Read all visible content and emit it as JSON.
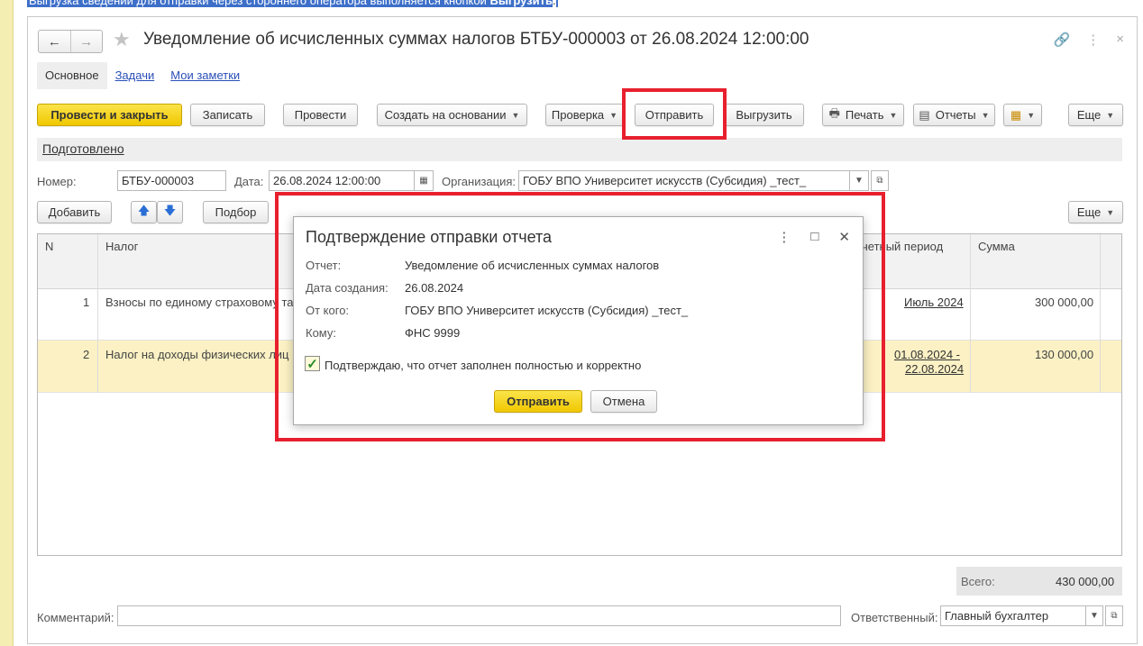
{
  "top_caption": {
    "text": "Выгрузка сведений для отправки через стороннего оператора выполняется кнопкой ",
    "bold": "Выгрузить",
    "tail": "."
  },
  "window": {
    "title": "Уведомление об исчисленных суммах налогов БТБУ-000003 от 26.08.2024 12:00:00",
    "nav_back": "←",
    "nav_forward": "→",
    "tools": [
      "🔗",
      "⋮",
      "×"
    ]
  },
  "tabs": [
    {
      "label": "Основное"
    },
    {
      "label": "Задачи"
    },
    {
      "label": "Мои заметки"
    }
  ],
  "toolbar": {
    "post_close": "Провести и закрыть",
    "save": "Записать",
    "post": "Провести",
    "create_based": "Создать на основании",
    "check": "Проверка",
    "send": "Отправить",
    "upload": "Выгрузить",
    "print": "Печать",
    "reports": "Отчеты",
    "more": "Еще"
  },
  "status": {
    "label": "Подготовлено"
  },
  "fields": {
    "number_label": "Номер:",
    "number_value": "БТБУ-000003",
    "date_label": "Дата:",
    "date_value": "26.08.2024 12:00:00",
    "org_label": "Организация:",
    "org_value": "ГОБУ ВПО Университет искусств (Субсидия) _тест_"
  },
  "table_toolbar": {
    "add": "Добавить",
    "select": "Подбор",
    "more": "Еще"
  },
  "table": {
    "headers": {
      "n": "N",
      "tax": "Налог",
      "period": "четный период",
      "sum": "Сумма"
    },
    "rows": [
      {
        "n": "1",
        "tax": "Взносы по единому страховому та",
        "period_line1": "Июль 2024",
        "period_line2": "",
        "sum": "300 000,00"
      },
      {
        "n": "2",
        "tax": "Налог на доходы физических лиц",
        "period_line1": "01.08.2024 -",
        "period_line2": "22.08.2024",
        "sum": "130 000,00"
      }
    ]
  },
  "totals": {
    "label": "Всего:",
    "value": "430 000,00"
  },
  "footer": {
    "comment_label": "Комментарий:",
    "comment_value": "",
    "responsible_label": "Ответственный:",
    "responsible_value": "Главный бухгалтер"
  },
  "dialog": {
    "title": "Подтверждение отправки отчета",
    "report_label": "Отчет:",
    "report_value": "Уведомление об исчисленных суммах налогов",
    "created_label": "Дата создания:",
    "created_value": "26.08.2024",
    "from_label": "От кого:",
    "from_value": "ГОБУ ВПО Университет искусств (Субсидия) _тест_",
    "to_label": "Кому:",
    "to_value": "ФНС 9999",
    "confirm_text": "Подтверждаю, что отчет заполнен полностью и корректно",
    "confirm_checked": true,
    "send_button": "Отправить",
    "cancel_button": "Отмена"
  },
  "colors": {
    "accent_yellow": "#f5d000",
    "highlight_red": "#e8202e",
    "selected_row": "#fbf1c4"
  }
}
